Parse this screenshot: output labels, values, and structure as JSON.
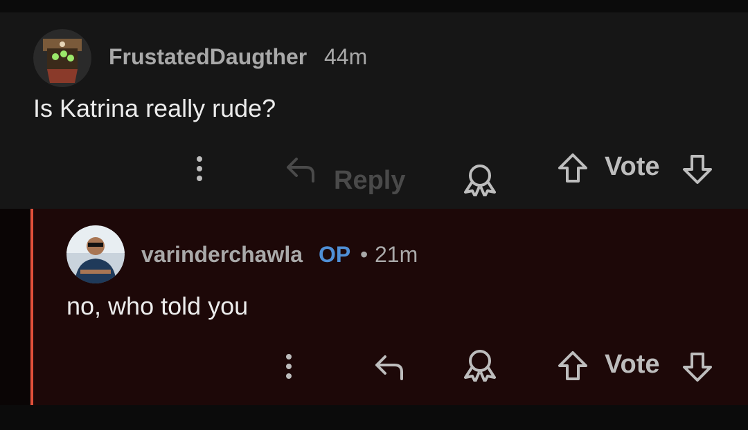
{
  "comments": [
    {
      "username": "FrustatedDaugther",
      "time": "44m",
      "body": "Is Katrina really rude?",
      "reply_label": "Reply",
      "vote_label": "Vote"
    },
    {
      "username": "varinderchawla",
      "op_badge": "OP",
      "separator": "•",
      "time": "21m",
      "body": "no, who told you",
      "vote_label": "Vote"
    }
  ],
  "colors": {
    "op_badge": "#4f8fd6",
    "thread_line": "#e0503a"
  },
  "icons": [
    "more-vertical-icon",
    "reply-arrow-icon",
    "award-icon",
    "upvote-arrow-icon",
    "downvote-arrow-icon"
  ]
}
